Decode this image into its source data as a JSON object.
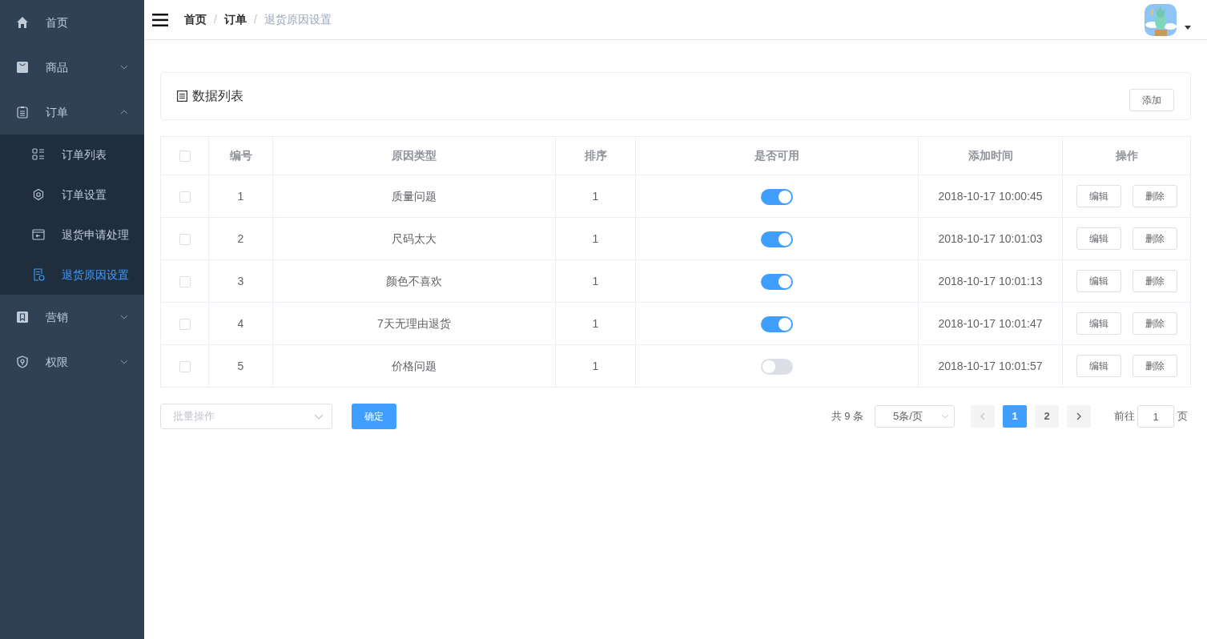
{
  "sidebar": {
    "items": [
      {
        "label": "首页",
        "selected": false
      },
      {
        "label": "商品",
        "selected": false,
        "expanded": false
      },
      {
        "label": "订单",
        "selected": false,
        "expanded": true,
        "children": [
          {
            "label": "订单列表",
            "selected": false
          },
          {
            "label": "订单设置",
            "selected": false
          },
          {
            "label": "退货申请处理",
            "selected": false
          },
          {
            "label": "退货原因设置",
            "selected": true
          }
        ]
      },
      {
        "label": "营销",
        "selected": false,
        "expanded": false
      },
      {
        "label": "权限",
        "selected": false,
        "expanded": false
      }
    ]
  },
  "breadcrumb": {
    "separator": "/",
    "items": [
      "首页",
      "订单",
      "退货原因设置"
    ]
  },
  "panel": {
    "title": "数据列表",
    "add_button": "添加"
  },
  "table": {
    "columns": [
      "编号",
      "原因类型",
      "排序",
      "是否可用",
      "添加时间",
      "操作"
    ],
    "header_checked": false,
    "rows": [
      {
        "checked": false,
        "id": "1",
        "reason": "质量问题",
        "sort": "1",
        "enabled": true,
        "time": "2018-10-17 10:00:45",
        "actions": [
          "编辑",
          "删除"
        ]
      },
      {
        "checked": false,
        "id": "2",
        "reason": "尺码太大",
        "sort": "1",
        "enabled": true,
        "time": "2018-10-17 10:01:03",
        "actions": [
          "编辑",
          "删除"
        ]
      },
      {
        "checked": false,
        "id": "3",
        "reason": "颜色不喜欢",
        "sort": "1",
        "enabled": true,
        "time": "2018-10-17 10:01:13",
        "actions": [
          "编辑",
          "删除"
        ]
      },
      {
        "checked": false,
        "id": "4",
        "reason": "7天无理由退货",
        "sort": "1",
        "enabled": true,
        "time": "2018-10-17 10:01:47",
        "actions": [
          "编辑",
          "删除"
        ]
      },
      {
        "checked": false,
        "id": "5",
        "reason": "价格问题",
        "sort": "1",
        "enabled": false,
        "time": "2018-10-17 10:01:57",
        "actions": [
          "编辑",
          "删除"
        ]
      }
    ]
  },
  "batch": {
    "placeholder": "批量操作",
    "confirm": "确定"
  },
  "pagination": {
    "total": "共 9 条",
    "page_size": "5条/页",
    "pages": [
      {
        "label": "1",
        "selected": true
      },
      {
        "label": "2",
        "selected": false
      }
    ],
    "goto_label": "前往",
    "goto_value": "1",
    "page_suffix": "页"
  }
}
